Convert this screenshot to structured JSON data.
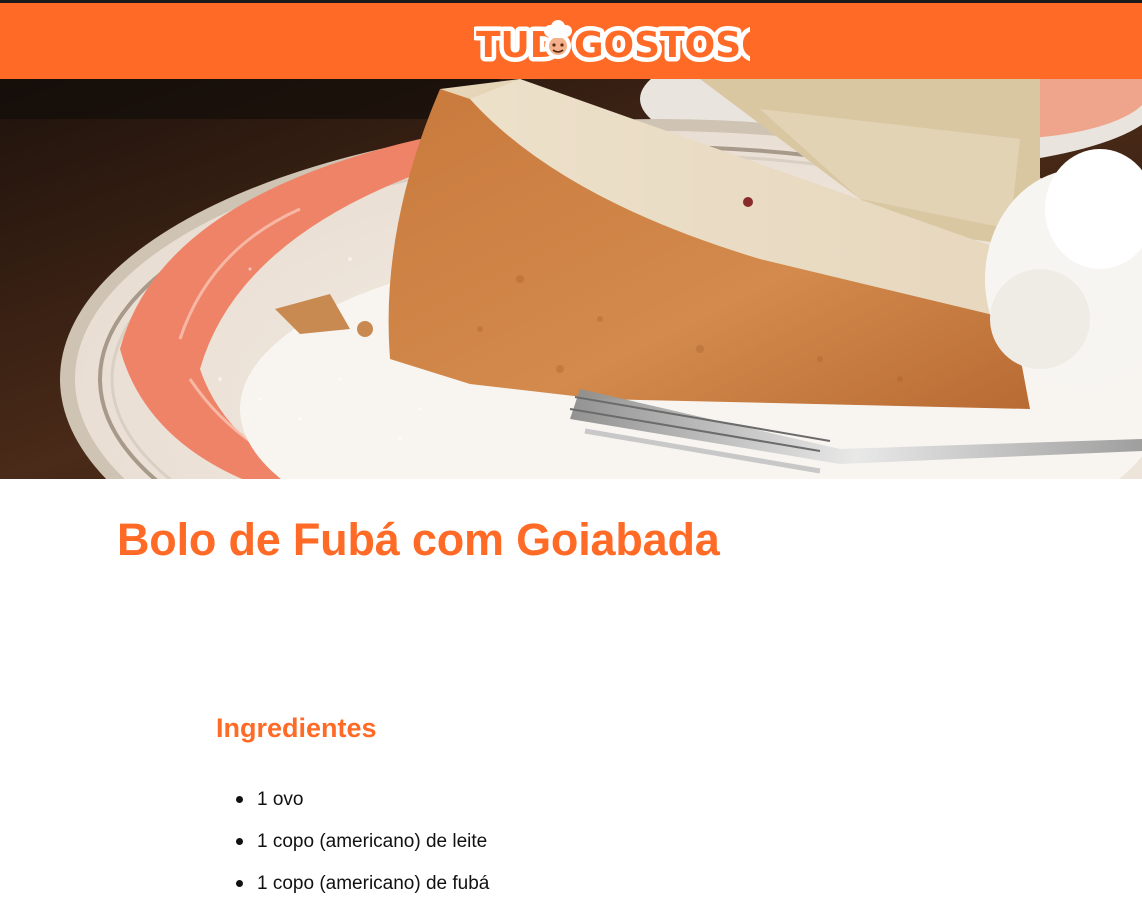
{
  "header": {
    "brand": "TUDOGOSTOSO",
    "brand_left": "TUD",
    "brand_right": "GOSTOSO",
    "logo_icon": "chef-hat-icon",
    "color": "#ff6b27"
  },
  "hero": {
    "image": "slice-of-cake-on-plate-with-fork"
  },
  "recipe": {
    "title": "Bolo de Fubá com Goiabada",
    "ingredients_heading": "Ingredientes",
    "ingredients": [
      "1 ovo",
      "1 copo (americano) de leite",
      "1 copo (americano) de fubá"
    ]
  },
  "colors": {
    "accent": "#ff6b27",
    "text": "#111111"
  }
}
